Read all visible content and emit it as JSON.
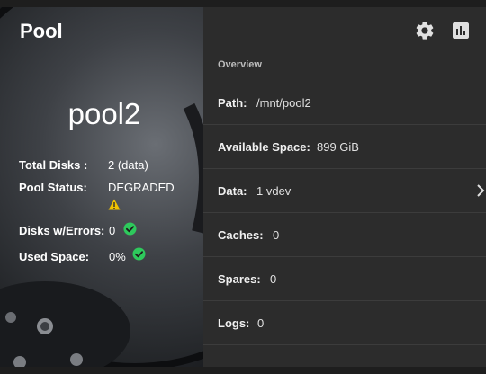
{
  "card": {
    "title": "Pool",
    "pool_name": "pool2"
  },
  "stats": {
    "total_disks_label": "Total Disks :",
    "total_disks_value": "2 (data)",
    "pool_status_label": "Pool Status:",
    "pool_status_value": "DEGRADED",
    "disks_errors_label": "Disks w/Errors:",
    "disks_errors_value": "0",
    "used_space_label": "Used Space:",
    "used_space_value": "0%"
  },
  "toolbar": {
    "settings_icon": "gear-icon",
    "reports_icon": "bar-chart-icon"
  },
  "overview": {
    "heading": "Overview",
    "rows": [
      {
        "label": "Path:",
        "value": "/mnt/pool2"
      },
      {
        "label": "Available Space:",
        "value": "899 GiB"
      },
      {
        "label": "Data:",
        "value": "1 vdev"
      },
      {
        "label": "Caches:",
        "value": "0"
      },
      {
        "label": "Spares:",
        "value": "0"
      },
      {
        "label": "Logs:",
        "value": "0"
      }
    ]
  },
  "colors": {
    "ok": "#2ec95c",
    "warning": "#f2c200",
    "panel": "#2c2c2c"
  }
}
